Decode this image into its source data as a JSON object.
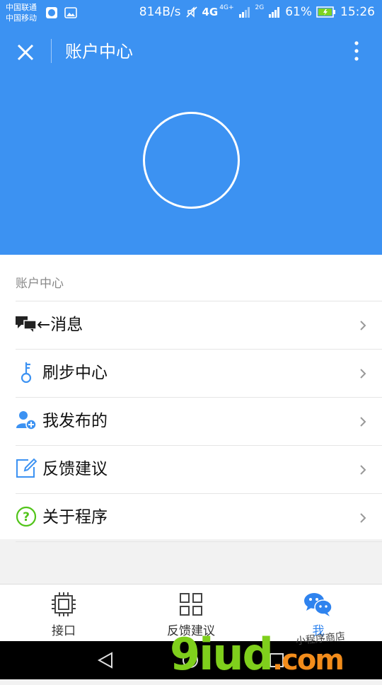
{
  "status_bar": {
    "carrier_1": "中国联通",
    "carrier_2": "中国移动",
    "net_speed": "814B/s",
    "net_4g_a": "4G",
    "net_4g_b": "4G+",
    "net_2g": "2G",
    "battery": "61%",
    "time": "15:26"
  },
  "header": {
    "title": "账户中心",
    "close_icon": "close-icon",
    "more_icon": "more-vertical-icon",
    "bg_color": "#3c92f2"
  },
  "menu": {
    "section_title": "账户中心",
    "items": [
      {
        "label": "←消息",
        "icon": "chat-bubbles-icon"
      },
      {
        "label": "刷步中心",
        "icon": "key-icon"
      },
      {
        "label": "我发布的",
        "icon": "user-add-icon"
      },
      {
        "label": "反馈建议",
        "icon": "edit-icon"
      },
      {
        "label": "关于程序",
        "icon": "question-icon"
      }
    ]
  },
  "tabbar": {
    "tabs": [
      {
        "label": "接口",
        "icon": "chip-icon",
        "active": false
      },
      {
        "label": "反馈建议",
        "icon": "grid-icon",
        "active": false
      },
      {
        "label": "我",
        "icon": "wechat-icon",
        "active": true
      }
    ],
    "active_color": "#2f83ee"
  },
  "watermark": {
    "main": "9iud",
    "suffix": ".com",
    "small": "小程序商店"
  }
}
